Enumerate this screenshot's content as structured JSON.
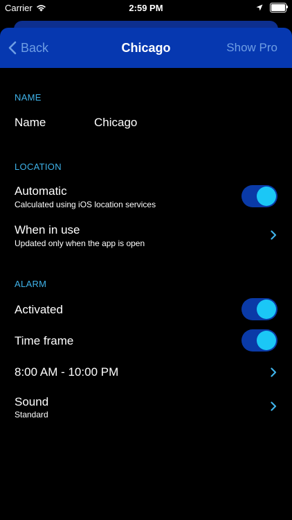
{
  "status_bar": {
    "carrier": "Carrier",
    "time": "2:59 PM"
  },
  "nav": {
    "back_label": "Back",
    "title": "Chicago",
    "right_label": "Show Pro"
  },
  "sections": {
    "name": {
      "header": "NAME",
      "row_label": "Name",
      "row_value": "Chicago"
    },
    "location": {
      "header": "LOCATION",
      "automatic": {
        "title": "Automatic",
        "subtitle": "Calculated using iOS location services",
        "on": true
      },
      "when_in_use": {
        "title": "When in use",
        "subtitle": "Updated only when the app is open"
      }
    },
    "alarm": {
      "header": "ALARM",
      "activated": {
        "title": "Activated",
        "on": true
      },
      "time_frame": {
        "title": "Time frame",
        "on": true
      },
      "time_range": {
        "title": "8:00 AM - 10:00 PM"
      },
      "sound": {
        "title": "Sound",
        "subtitle": "Standard"
      }
    }
  },
  "colors": {
    "nav_background": "#0638b0",
    "accent": "#3fb3ea",
    "toggle_track": "#0a3aa7",
    "toggle_knob": "#1bc7f6"
  }
}
